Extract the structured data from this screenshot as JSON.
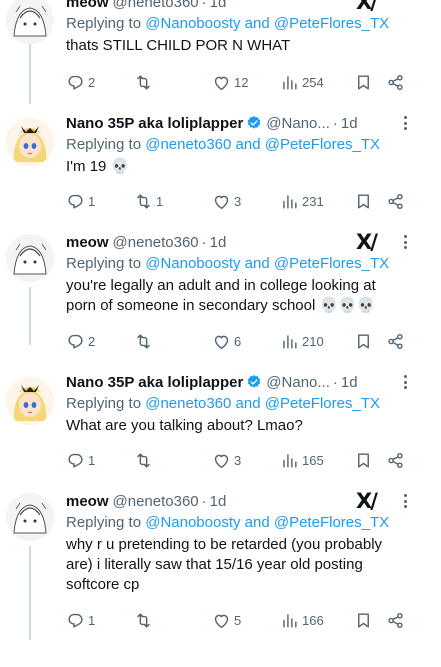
{
  "tweets": [
    {
      "name": "meow",
      "handle": "@neneto360",
      "time": "1d",
      "replying_prefix": "Replying to",
      "replying_mentions": "@Nanoboosty and @PeteFlores_TX",
      "text": "thats STILL CHILD POR N WHAT",
      "replies": "2",
      "retweets": "",
      "likes": "12",
      "views": "254"
    },
    {
      "name": "Nano 35P aka loliplapper",
      "handle": "@Nano...",
      "time": "1d",
      "replying_prefix": "Replying to",
      "replying_mentions": "@neneto360 and @PeteFlores_TX",
      "text": "I'm 19 💀",
      "replies": "1",
      "retweets": "1",
      "likes": "3",
      "views": "231"
    },
    {
      "name": "meow",
      "handle": "@neneto360",
      "time": "1d",
      "replying_prefix": "Replying to",
      "replying_mentions": "@Nanoboosty and @PeteFlores_TX",
      "text": "you're legally an adult and in college looking at porn of someone in secondary school 💀💀💀",
      "replies": "2",
      "retweets": "",
      "likes": "6",
      "views": "210"
    },
    {
      "name": "Nano 35P aka loliplapper",
      "handle": "@Nano...",
      "time": "1d",
      "replying_prefix": "Replying to",
      "replying_mentions": "@neneto360 and @PeteFlores_TX",
      "text": "What are you talking about? Lmao?",
      "replies": "1",
      "retweets": "",
      "likes": "3",
      "views": "165"
    },
    {
      "name": "meow",
      "handle": "@neneto360",
      "time": "1d",
      "replying_prefix": "Replying to",
      "replying_mentions": "@Nanoboosty and @PeteFlores_TX",
      "text": "why r u pretending to be retarded (you probably are) i literally saw that 15/16 year old posting softcore cp",
      "replies": "1",
      "retweets": "",
      "likes": "5",
      "views": "166"
    }
  ],
  "ui": {
    "dot": "·",
    "x_logo": "X/",
    "colors": {
      "accent": "#1d9bf0",
      "muted": "#536471",
      "text": "#0f1419",
      "verified": "#1d9bf0",
      "divider": "#cfd9de"
    },
    "icons": [
      "reply-icon",
      "retweet-icon",
      "like-icon",
      "views-icon",
      "bookmark-icon",
      "share-icon",
      "verified-badge-icon",
      "more-icon",
      "x-logo-icon"
    ]
  }
}
